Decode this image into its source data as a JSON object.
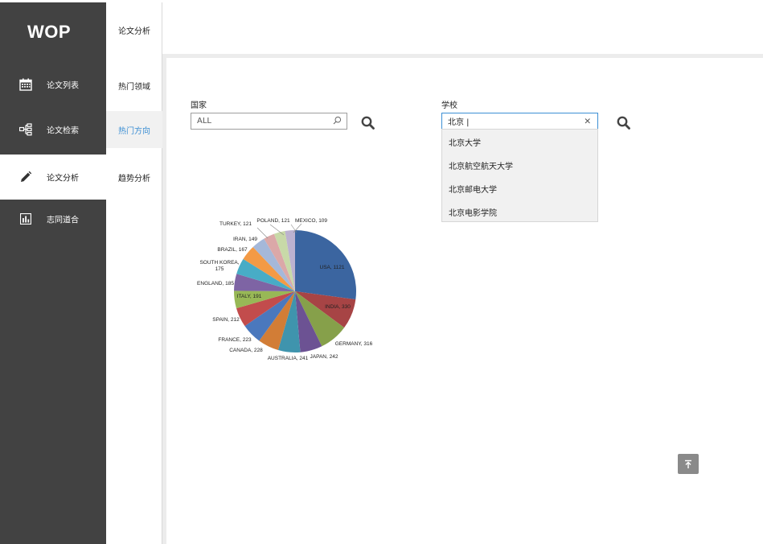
{
  "app": {
    "logo": "WOP"
  },
  "sidebar": {
    "items": [
      {
        "label": "论文列表",
        "icon": "calendar-icon"
      },
      {
        "label": "论文检索",
        "icon": "sitemap-icon"
      },
      {
        "label": "论文分析",
        "icon": "pencil-icon",
        "active": true
      },
      {
        "label": "志同道合",
        "icon": "bar-chart-icon"
      }
    ]
  },
  "subnav": {
    "title": "论文分析",
    "items": [
      {
        "label": "热门领域"
      },
      {
        "label": "热门方向",
        "active": true
      },
      {
        "label": "趋势分析"
      }
    ]
  },
  "filters": {
    "country": {
      "label": "国家",
      "value": "ALL"
    },
    "school": {
      "label": "学校",
      "value": "北京 |"
    }
  },
  "dropdown": {
    "options": [
      "北京大学",
      "北京航空航天大学",
      "北京邮电大学",
      "北京电影学院"
    ]
  },
  "chart_data": {
    "type": "pie",
    "categories": [
      "USA",
      "INDIA",
      "GERMANY",
      "JAPAN",
      "AUSTRALIA",
      "CANADA",
      "FRANCE",
      "SPAIN",
      "ITALY",
      "ENGLAND",
      "SOUTH KOREA",
      "BRAZIL",
      "IRAN",
      "TURKEY",
      "POLAND",
      "MEXICO"
    ],
    "values": [
      1121,
      330,
      316,
      242,
      241,
      228,
      223,
      212,
      191,
      185,
      175,
      167,
      149,
      121,
      121,
      109
    ],
    "labels": [
      "USA, 1121",
      "INDIA, 330",
      "GERMANY, 316",
      "JAPAN, 242",
      "AUSTRALIA, 241",
      "CANADA, 228",
      "FRANCE, 223",
      "SPAIN, 212",
      "ITALY, 191",
      "ENGLAND, 185",
      "SOUTH KOREA, 175",
      "BRAZIL, 167",
      "IRAN, 149",
      "TURKEY, 121",
      "POLAND, 121",
      "MEXICO, 109"
    ],
    "colors": [
      "#3b65a0",
      "#a74445",
      "#86a04a",
      "#6c5293",
      "#3f94ad",
      "#d27d36",
      "#4a78bd",
      "#c24c4c",
      "#98b856",
      "#7e64a4",
      "#48acc6",
      "#f39a45",
      "#a5b8d9",
      "#dba8a8",
      "#c8d9a8",
      "#bcb2d0"
    ]
  }
}
